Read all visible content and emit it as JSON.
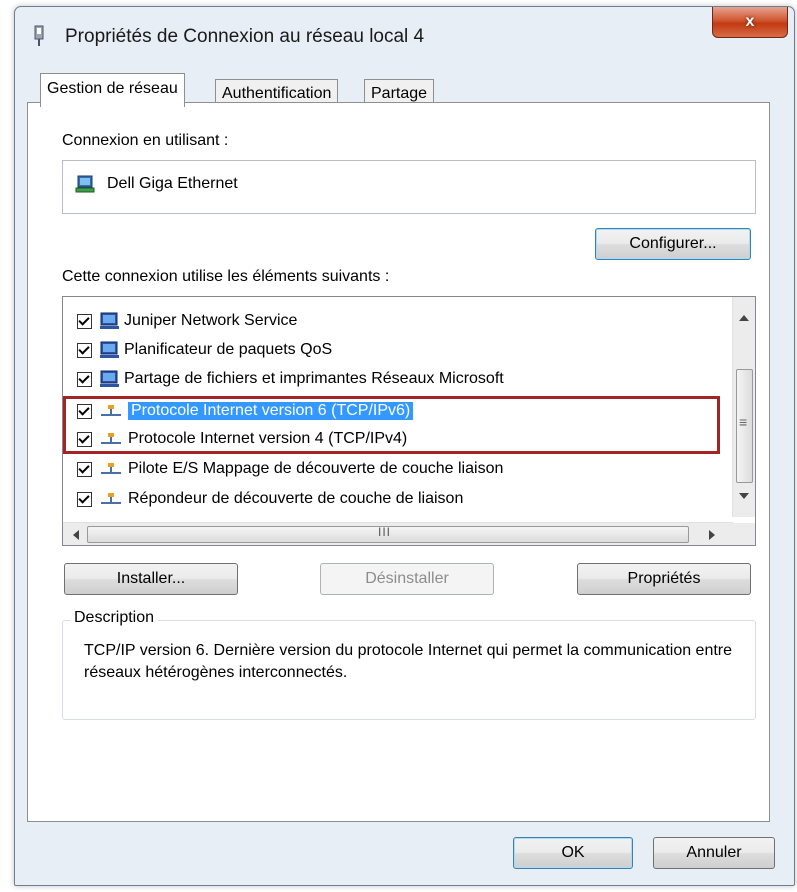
{
  "window": {
    "title": "Propriétés de Connexion au réseau local 4",
    "close_label": "x"
  },
  "tabs": [
    {
      "label": "Gestion de réseau",
      "active": true
    },
    {
      "label": "Authentification",
      "active": false
    },
    {
      "label": "Partage",
      "active": false
    }
  ],
  "connect_using": {
    "label": "Connexion en utilisant :",
    "adapter": "Dell Giga Ethernet",
    "configure_label": "Configurer..."
  },
  "items_label": "Cette connexion utilise les éléments suivants :",
  "items": [
    {
      "label": "Juniper Network Service",
      "icon": "network-client-icon",
      "checked": true
    },
    {
      "label": "Planificateur de paquets QoS",
      "icon": "network-client-icon",
      "checked": true
    },
    {
      "label": "Partage de fichiers et imprimantes Réseaux Microsoft",
      "icon": "network-client-icon",
      "checked": true
    },
    {
      "label": "Protocole Internet version 6 (TCP/IPv6)",
      "icon": "protocol-icon",
      "checked": true,
      "selected": true
    },
    {
      "label": "Protocole Internet version 4 (TCP/IPv4)",
      "icon": "protocol-icon",
      "checked": true
    },
    {
      "label": "Pilote E/S Mappage de découverte de couche liaison",
      "icon": "protocol-icon",
      "checked": true
    },
    {
      "label": "Répondeur de découverte de couche de liaison",
      "icon": "protocol-icon",
      "checked": true
    }
  ],
  "hscroll_thumb_glyph": "III",
  "vscroll_thumb_glyph": "≡",
  "buttons": {
    "install": "Installer...",
    "uninstall": "Désinstaller",
    "properties": "Propriétés",
    "ok": "OK",
    "cancel": "Annuler"
  },
  "description": {
    "title": "Description",
    "text": "TCP/IP version 6. Dernière version du protocole Internet qui permet la communication entre réseaux hétérogènes interconnectés."
  },
  "colors": {
    "selection": "#3399ff",
    "highlight_box": "#a32424",
    "close_button": "#c94a24"
  }
}
